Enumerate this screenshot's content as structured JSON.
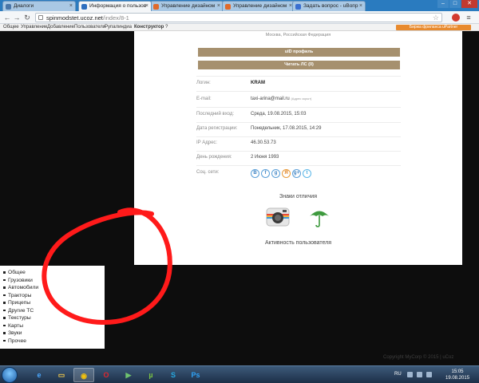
{
  "browser": {
    "tabs": [
      {
        "label": "Диалоги",
        "favicon_color": "#4a76a8",
        "active": false
      },
      {
        "label": "Информация о пользов",
        "favicon_color": "#2e6fbf",
        "active": true
      },
      {
        "label": "Управление дизайном",
        "favicon_color": "#e06a2b",
        "active": false
      },
      {
        "label": "Управление дизайном",
        "favicon_color": "#e06a2b",
        "active": false
      },
      {
        "label": "Задать вопрос - uВопр",
        "favicon_color": "#3a6fd0",
        "active": false
      }
    ],
    "url_host": "spinmodstet.ucoz.net",
    "url_path": "/index/8-1",
    "window_buttons": [
      "–",
      "□",
      "✕"
    ]
  },
  "admin_bar": {
    "items": [
      "Общее",
      "Управление",
      "Добавление",
      "Пользователи",
      "Рупалиндиа",
      "Конструктор",
      "?"
    ],
    "partner_label": "Биржа фриланса uPartner"
  },
  "profile": {
    "location": "Москва, Российская Федерация",
    "profile_button": "uID профиль",
    "message_button": "Читать ЛС (0)",
    "fields": [
      {
        "label": "Логин:",
        "value": "KRAM",
        "bold": true
      },
      {
        "label": "E-mail:",
        "value": "taxi-arina@mail.ru",
        "note": "(Адрес скрыт)"
      },
      {
        "label": "Последний вход:",
        "value": "Среда, 19.08.2015, 15:03"
      },
      {
        "label": "Дата регистрации:",
        "value": "Понедельник, 17.08.2015, 14:29"
      },
      {
        "label": "IP Адрес:",
        "value": "46.30.53.73"
      },
      {
        "label": "День рождения:",
        "value": "2 Июня 1993"
      }
    ],
    "social_label": "Соц. сети:",
    "social_icons": [
      "В",
      "f",
      "g",
      "Я",
      "g+",
      "t"
    ],
    "badges_title": "Знаки отличия",
    "activity_title": "Активность пользователя"
  },
  "categories": [
    "Общее",
    "Грузовики",
    "Автомобили",
    "Тракторы",
    "Прицепы",
    "Другие ТС",
    "Текстуры",
    "Карты",
    "Звуки",
    "Прочее"
  ],
  "footer": {
    "copyright": "Copyright MyCorp © 2015 | uCoz"
  },
  "taskbar": {
    "apps": [
      {
        "name": "ie-icon",
        "glyph": "e",
        "color": "#4aa8ff"
      },
      {
        "name": "explorer-icon",
        "glyph": "▭",
        "color": "#f2c94c"
      },
      {
        "name": "chrome-icon",
        "glyph": "◉",
        "color": "#f4c20d",
        "active": true
      },
      {
        "name": "opera-icon",
        "glyph": "O",
        "color": "#e0262d"
      },
      {
        "name": "media-player-icon",
        "glyph": "▶",
        "color": "#6fc36f"
      },
      {
        "name": "utorrent-icon",
        "glyph": "µ",
        "color": "#7ac143"
      },
      {
        "name": "skype-icon",
        "glyph": "S",
        "color": "#27a9e1"
      },
      {
        "name": "photoshop-icon",
        "glyph": "Ps",
        "color": "#2fa3f7"
      }
    ],
    "lang": "RU",
    "time": "15:05",
    "date": "19.08.2015"
  }
}
